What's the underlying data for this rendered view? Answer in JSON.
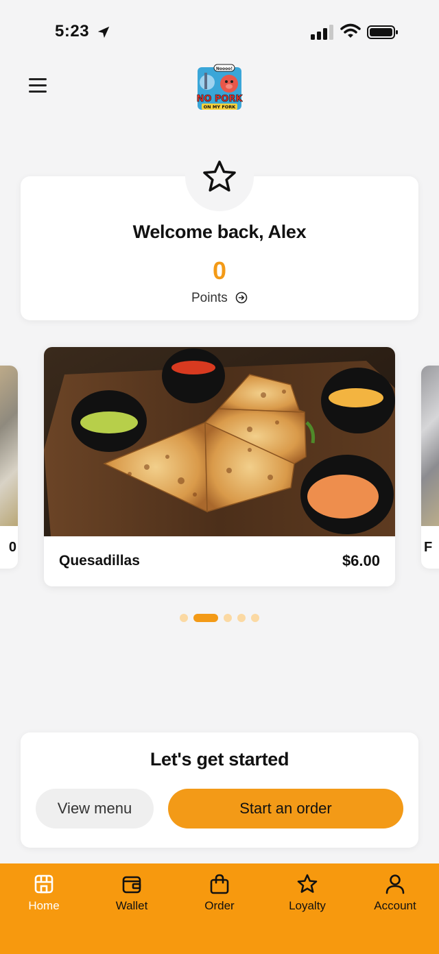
{
  "status_bar": {
    "time": "5:23",
    "icons": [
      "location-arrow-icon",
      "signal-icon",
      "wifi-icon",
      "battery-icon"
    ]
  },
  "header": {
    "menu_icon": "hamburger-menu-icon",
    "logo": {
      "line1": "NO PORK",
      "line2": "ON MY FORK",
      "speech": "Noooo!"
    }
  },
  "welcome": {
    "icon": "star-icon",
    "greeting": "Welcome back, Alex",
    "points_value": "0",
    "points_label": "Points",
    "points_link_icon": "arrow-circle-right-icon"
  },
  "carousel": {
    "left_peek_label": "0",
    "right_peek_label": "F",
    "featured": {
      "name": "Quesadillas",
      "price": "$6.00"
    },
    "dot_count": 5,
    "active_dot": 1
  },
  "get_started": {
    "title": "Let's get started",
    "view_menu_label": "View menu",
    "start_order_label": "Start an order"
  },
  "bottom_nav": {
    "items": [
      {
        "label": "Home",
        "icon": "store-icon",
        "active": true
      },
      {
        "label": "Wallet",
        "icon": "wallet-icon",
        "active": false
      },
      {
        "label": "Order",
        "icon": "shopping-bag-icon",
        "active": false
      },
      {
        "label": "Loyalty",
        "icon": "star-icon",
        "active": false
      },
      {
        "label": "Account",
        "icon": "person-icon",
        "active": false
      }
    ]
  },
  "colors": {
    "accent": "#f39a17",
    "nav_background": "#f7990e",
    "background": "#f4f4f5",
    "dot_inactive": "#fbd9a3"
  }
}
